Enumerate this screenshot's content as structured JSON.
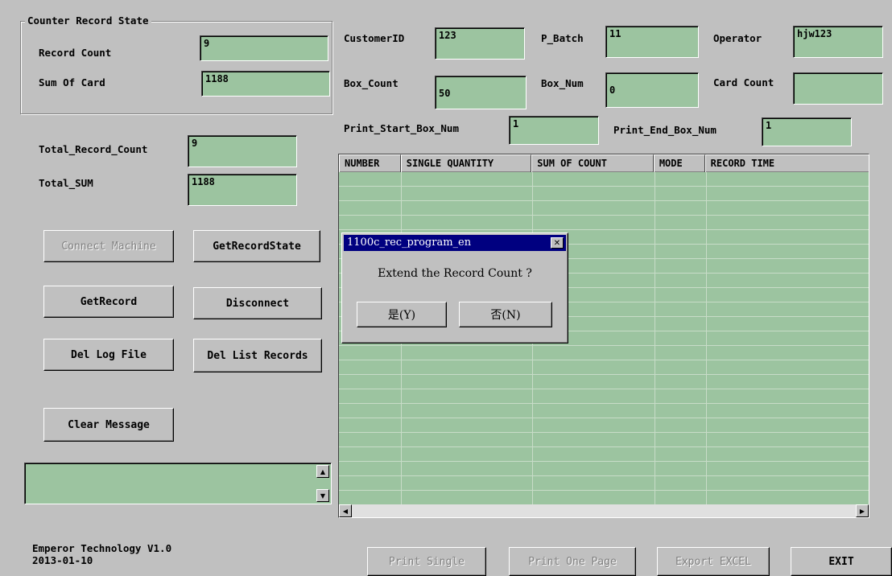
{
  "record_state": {
    "title": "Counter Record State",
    "record_count_label": "Record Count",
    "record_count_value": "9",
    "sum_of_card_label": "Sum Of Card",
    "sum_of_card_value": "1188"
  },
  "totals": {
    "total_record_count_label": "Total_Record_Count",
    "total_record_count_value": "9",
    "total_sum_label": "Total_SUM",
    "total_sum_value": "1188"
  },
  "top_fields": {
    "customer_id_label": "CustomerID",
    "customer_id_value": "123",
    "p_batch_label": "P_Batch",
    "p_batch_value": "11",
    "operator_label": "Operator",
    "operator_value": "hjw123",
    "box_count_label": "Box_Count",
    "box_count_value": "50",
    "box_num_label": "Box_Num",
    "box_num_value": "0",
    "card_count_label": "Card Count",
    "card_count_value": "",
    "print_start_label": "Print_Start_Box_Num",
    "print_start_value": "1",
    "print_end_label": "Print_End_Box_Num",
    "print_end_value": "1"
  },
  "buttons": {
    "connect_machine": "Connect Machine",
    "get_record_state": "GetRecordState",
    "get_record": "GetRecord",
    "disconnect": "Disconnect",
    "del_log_file": "Del Log File",
    "del_list_records": "Del List Records",
    "clear_message": "Clear Message",
    "print_single": "Print Single",
    "print_one_page": "Print One Page",
    "export_excel": "Export EXCEL",
    "exit": "EXIT"
  },
  "grid": {
    "columns": [
      "NUMBER",
      "SINGLE QUANTITY",
      "SUM OF COUNT",
      "MODE",
      "RECORD TIME"
    ]
  },
  "dialog": {
    "title": "1100c_rec_program_en",
    "message": "Extend the Record Count ?",
    "yes": "是(Y)",
    "no": "否(N)"
  },
  "footer": {
    "company": "Emperor Technology  V1.0",
    "date": "2013-01-10"
  },
  "colors": {
    "field_bg": "#9cc4a0",
    "window_bg": "#c0c0c0",
    "title_bar": "#000080"
  }
}
